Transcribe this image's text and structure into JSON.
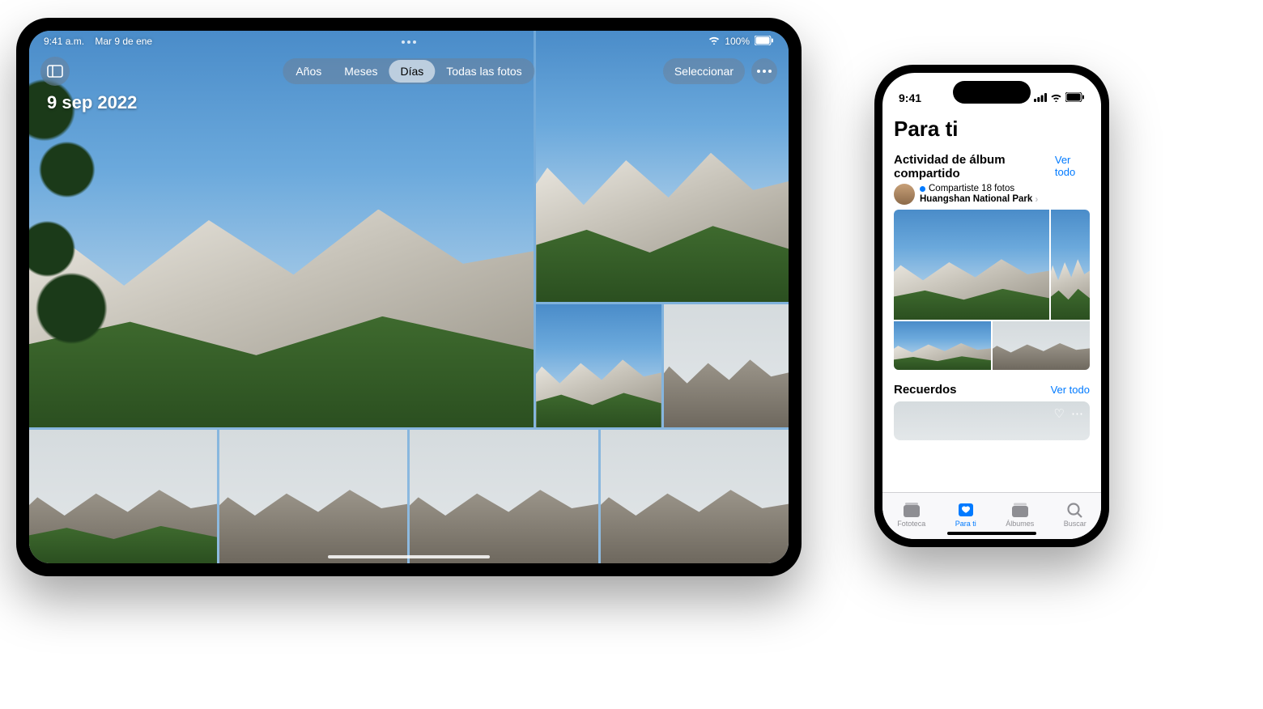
{
  "ipad": {
    "status": {
      "time": "9:41 a.m.",
      "date": "Mar 9 de ene",
      "battery": "100%"
    },
    "segments": {
      "years": "Años",
      "months": "Meses",
      "days": "Días",
      "all": "Todas las fotos",
      "active": "days"
    },
    "select_label": "Seleccionar",
    "date_heading": "9 sep 2022"
  },
  "iphone": {
    "status": {
      "time": "9:41"
    },
    "title": "Para ti",
    "shared_activity": {
      "heading": "Actividad de álbum compartido",
      "see_all": "Ver todo",
      "line1": "Compartiste 18 fotos",
      "line2": "Huangshan National Park"
    },
    "memories": {
      "heading": "Recuerdos",
      "see_all": "Ver todo"
    },
    "tabs": {
      "library": "Fototeca",
      "for_you": "Para ti",
      "albums": "Álbumes",
      "search": "Buscar"
    }
  }
}
